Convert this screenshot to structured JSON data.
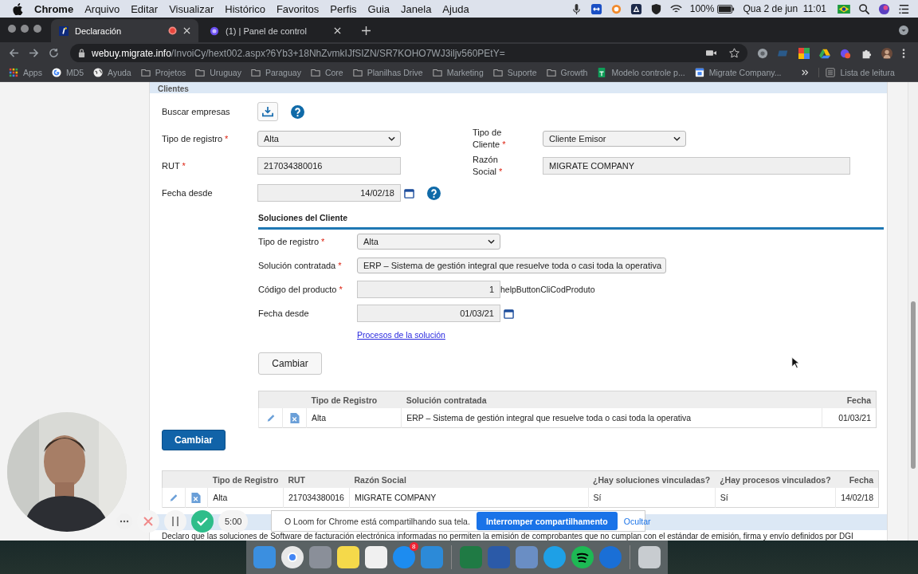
{
  "menubar": {
    "app": "Chrome",
    "menus": [
      "Arquivo",
      "Editar",
      "Visualizar",
      "Histórico",
      "Favoritos",
      "Perfis",
      "Guia",
      "Janela",
      "Ajuda"
    ],
    "battery": "100%",
    "clock": "Qua 2 de jun  11:01"
  },
  "tabs": [
    {
      "title": "Declaración",
      "selected": true,
      "recording": true
    },
    {
      "title": "(1) | Panel de control",
      "selected": false,
      "recording": false
    }
  ],
  "address": {
    "domain": "webuy.migrate.info",
    "path": "/InvoiCy/hext002.aspx?6Yb3+18NhZvmkIJfSIZN/SR7KOHO7WJ3iljv560PEtY="
  },
  "bookmarks": [
    {
      "label": "Apps",
      "kind": "apps"
    },
    {
      "label": "MD5",
      "kind": "google"
    },
    {
      "label": "Ayuda",
      "kind": "globe"
    },
    {
      "label": "Projetos",
      "kind": "folder"
    },
    {
      "label": "Uruguay",
      "kind": "folder"
    },
    {
      "label": "Paraguay",
      "kind": "folder"
    },
    {
      "label": "Core",
      "kind": "folder"
    },
    {
      "label": "Planilhas Drive",
      "kind": "folder"
    },
    {
      "label": "Marketing",
      "kind": "folder"
    },
    {
      "label": "Suporte",
      "kind": "folder"
    },
    {
      "label": "Growth",
      "kind": "folder"
    },
    {
      "label": "Modelo controle p...",
      "kind": "sheet"
    },
    {
      "label": "Migrate Company...",
      "kind": "calendar"
    }
  ],
  "reading_list": "Lista de leitura",
  "clientes": {
    "title": "Clientes",
    "search_label": "Buscar empresas",
    "left_fields": [
      {
        "label": "Tipo de registro",
        "required": "*",
        "kind": "select",
        "value": "Alta"
      },
      {
        "label": "RUT",
        "required": "*",
        "kind": "input",
        "value": "217034380016"
      },
      {
        "label": "Fecha desde",
        "kind": "date",
        "value": "14/02/18"
      }
    ],
    "right_fields": [
      {
        "label": "Tipo de Cliente",
        "required": "*",
        "kind": "select",
        "value": "Cliente Emisor"
      },
      {
        "label": "Razón Social",
        "required": "*",
        "kind": "input",
        "value": "MIGRATE COMPANY"
      }
    ]
  },
  "soluciones": {
    "title": "Soluciones del Cliente",
    "fields": [
      {
        "label": "Tipo de registro",
        "required": "*",
        "kind": "select",
        "value": "Alta"
      },
      {
        "label": "Solución contratada",
        "required": "*",
        "kind": "select",
        "value": "ERP – Sistema de gestión integral que resuelve toda o casi toda la operativa"
      },
      {
        "label": "Código del producto",
        "required": "*",
        "kind": "number",
        "value": "1",
        "note": "helpButtonCliCodProduto"
      },
      {
        "label": "Fecha desde",
        "kind": "date",
        "value": "01/03/21"
      }
    ],
    "link": "Procesos de la solución",
    "button": "Cambiar",
    "table": {
      "columns": [
        "Tipo de Registro",
        "Solución contratada",
        "Fecha"
      ],
      "rows": [
        [
          "Alta",
          "ERP – Sistema de gestión integral que resuelve toda o casi toda la operativa",
          "01/03/21"
        ]
      ]
    }
  },
  "primary_button": "Cambiar",
  "clients_table": {
    "columns": [
      "Tipo de Registro",
      "RUT",
      "Razón Social",
      "¿Hay soluciones vinculadas?",
      "¿Hay procesos vinculados?",
      "Fecha"
    ],
    "rows": [
      [
        "Alta",
        "217034380016",
        "MIGRATE COMPANY",
        "Sí",
        "Sí",
        "14/02/18"
      ]
    ]
  },
  "declaration": "Declaro que las soluciones de Software de facturación electrónica informadas no permiten la emisión de comprobantes que no cumplan con el estándar de emisión, firma y envío definidos por DGI",
  "recorder": {
    "timer": "5:00"
  },
  "sharing_bar": {
    "message": "O Loom for Chrome está compartilhando sua tela.",
    "stop": "Interromper compartilhamento",
    "hide": "Ocultar"
  },
  "dock": [
    {
      "kind": "finder"
    },
    {
      "kind": "chrome"
    },
    {
      "kind": "rocket"
    },
    {
      "kind": "notes"
    },
    {
      "kind": "chart"
    },
    {
      "kind": "store",
      "badge": "8"
    },
    {
      "kind": "code"
    },
    {
      "kind": "sep"
    },
    {
      "kind": "excel"
    },
    {
      "kind": "word"
    },
    {
      "kind": "preview"
    },
    {
      "kind": "skype"
    },
    {
      "kind": "spotify"
    },
    {
      "kind": "teamviewer"
    },
    {
      "kind": "sep"
    },
    {
      "kind": "trash"
    }
  ]
}
